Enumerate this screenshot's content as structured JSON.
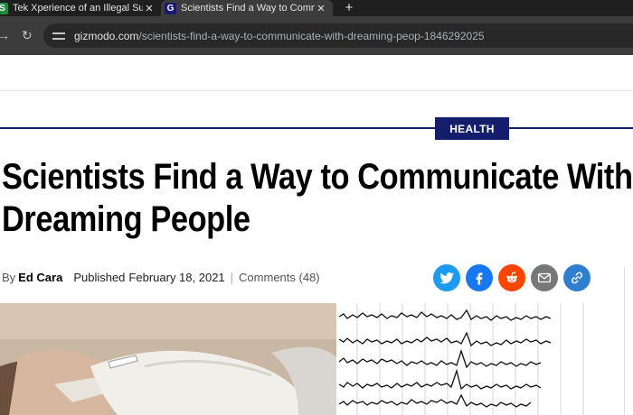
{
  "browser": {
    "tabs": [
      {
        "label": "Tek Xperience of an Illegal Surv",
        "favicon": "S"
      },
      {
        "label": "Scientists Find a Way to Comm",
        "favicon": "G"
      }
    ],
    "url_host": "gizmodo.com",
    "url_path": "/scientists-find-a-way-to-communicate-with-dreaming-peop-1846292025"
  },
  "article": {
    "category": "HEALTH",
    "headline_line1": "Scientists Find a Way to Communicate With",
    "headline_line2": "Dreaming People",
    "by": "By",
    "author": "Ed Cara",
    "published_label": "Published",
    "date": "February 18, 2021",
    "separator": "|",
    "comments": "Comments (48)"
  },
  "share": [
    {
      "name": "twitter-icon",
      "color": "#1d9bf0"
    },
    {
      "name": "facebook-icon",
      "color": "#1877f2"
    },
    {
      "name": "reddit-icon",
      "color": "#ff4500"
    },
    {
      "name": "email-icon",
      "color": "#777777"
    },
    {
      "name": "link-icon",
      "color": "#2f7fd1"
    }
  ],
  "colors": {
    "brand": "#141e6c"
  }
}
